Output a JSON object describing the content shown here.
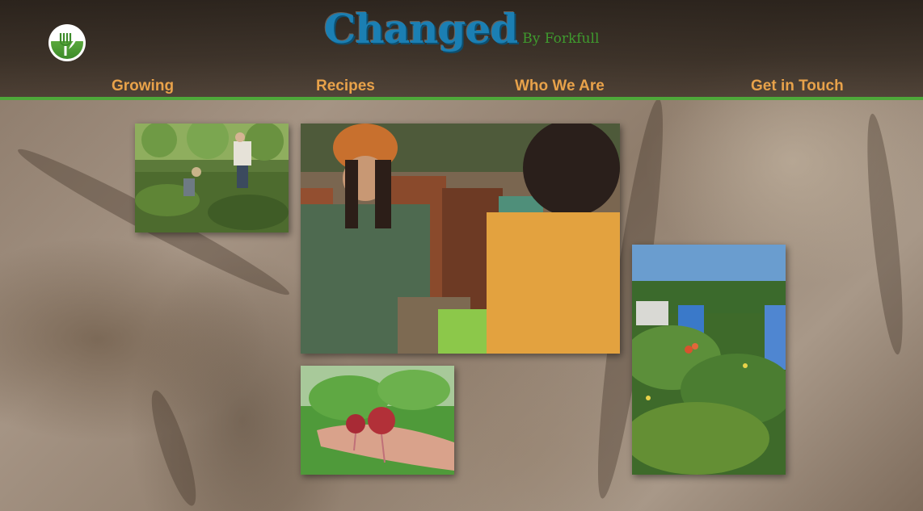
{
  "site": {
    "title": "Changed",
    "subtitle": "By Forkfull",
    "logo_icon": "fork-leaf-icon"
  },
  "nav": {
    "items": [
      {
        "label": "Growing"
      },
      {
        "label": "Recipes"
      },
      {
        "label": "Who We Are"
      },
      {
        "label": "Get in Touch"
      }
    ]
  },
  "colors": {
    "accent_green": "#4ea83a",
    "title_blue": "#1b7fb3",
    "nav_orange": "#e8a24a"
  },
  "gallery": {
    "photos": [
      {
        "subject": "gardeners-hoeing-field"
      },
      {
        "subject": "women-with-vegetables"
      },
      {
        "subject": "hand-holding-radishes"
      },
      {
        "subject": "community-garden-barrels"
      }
    ]
  }
}
